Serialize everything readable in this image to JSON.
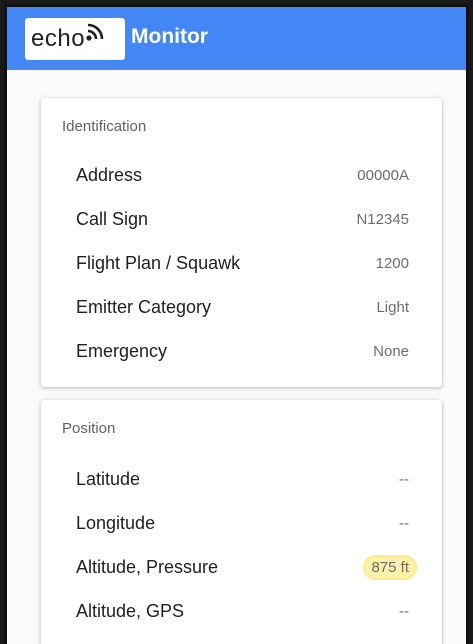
{
  "app": {
    "logo_text": "echo",
    "title": "Monitor"
  },
  "identification": {
    "title": "Identification",
    "rows": [
      {
        "label": "Address",
        "value": "00000A"
      },
      {
        "label": "Call Sign",
        "value": "N12345"
      },
      {
        "label": "Flight Plan / Squawk",
        "value": "1200"
      },
      {
        "label": "Emitter Category",
        "value": "Light"
      },
      {
        "label": "Emergency",
        "value": "None"
      }
    ]
  },
  "position": {
    "title": "Position",
    "rows": [
      {
        "label": "Latitude",
        "value": "--"
      },
      {
        "label": "Longitude",
        "value": "--"
      },
      {
        "label": "Altitude, Pressure",
        "value": "875 ft"
      },
      {
        "label": "Altitude, GPS",
        "value": "--"
      }
    ]
  },
  "colors": {
    "appbar": "#4287f5",
    "highlight": "#fbf1a8"
  },
  "icons": {
    "logo_wave": "signal-wave-icon"
  }
}
